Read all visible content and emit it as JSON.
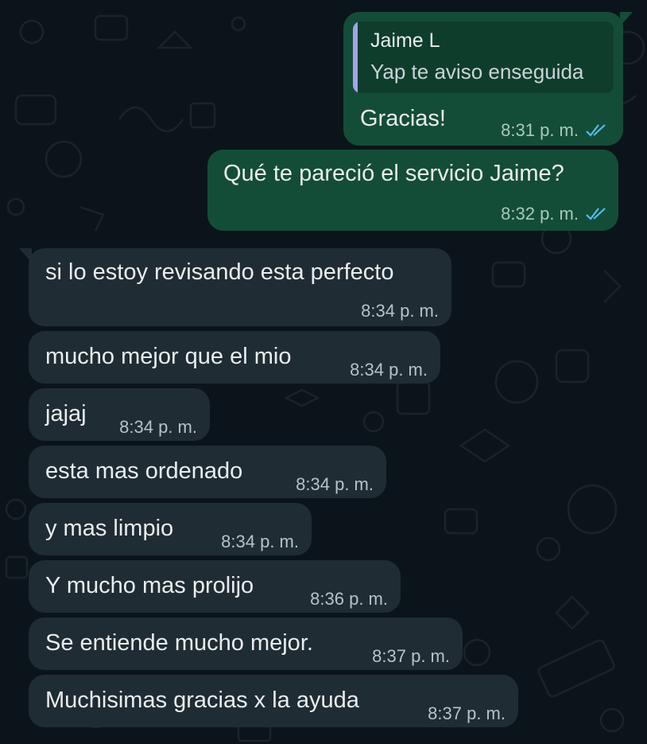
{
  "colors": {
    "background": "#0b141a",
    "outgoing_bubble": "#144d37",
    "incoming_bubble": "#202c33",
    "read_ticks": "#53bdeb",
    "quote_bar": "#a5a3e8"
  },
  "messages": {
    "m1": {
      "direction": "outgoing",
      "quote": {
        "author": "Jaime L",
        "text": "Yap te aviso enseguida"
      },
      "text": "Gracias!",
      "time": "8:31 p. m.",
      "status_icon": "double-check-read-icon"
    },
    "m2": {
      "direction": "outgoing",
      "text": "Qué te pareció el servicio Jaime?",
      "time": "8:32 p. m.",
      "status_icon": "double-check-read-icon"
    },
    "m3": {
      "direction": "incoming",
      "text": "si lo estoy revisando esta perfecto",
      "time": "8:34 p. m."
    },
    "m4": {
      "direction": "incoming",
      "text": "mucho mejor que el mio",
      "time": "8:34 p. m."
    },
    "m5": {
      "direction": "incoming",
      "text": "jajaj",
      "time": "8:34 p. m."
    },
    "m6": {
      "direction": "incoming",
      "text": "esta mas ordenado",
      "time": "8:34 p. m."
    },
    "m7": {
      "direction": "incoming",
      "text": "y mas limpio",
      "time": "8:34 p. m."
    },
    "m8": {
      "direction": "incoming",
      "text": "Y mucho mas prolijo",
      "time": "8:36 p. m."
    },
    "m9": {
      "direction": "incoming",
      "text": "Se entiende mucho mejor.",
      "time": "8:37 p. m."
    },
    "m10": {
      "direction": "incoming",
      "text": "Muchisimas gracias x la ayuda",
      "time": "8:37 p. m."
    }
  }
}
